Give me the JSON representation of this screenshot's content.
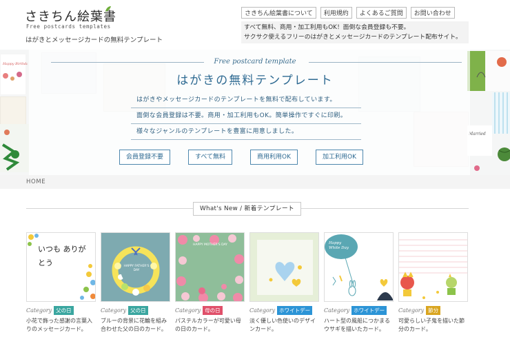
{
  "header": {
    "logo_title": "さきちん絵葉書",
    "logo_sub": "Free postcards templates",
    "tagline": "はがきとメッセージカードの無料テンプレート",
    "nav": [
      "さきちん絵葉書について",
      "利用規約",
      "よくあるご質問",
      "お問い合わせ"
    ],
    "desc_line1": "すべて無料、商用・加工利用もOK！面倒な会員登録も不要。",
    "desc_line2": "サクサク使えるフリーのはがきとメッセージカードのテンプレート配布サイト。"
  },
  "hero": {
    "script": "Free postcard template",
    "title": "はがきの無料テンプレート",
    "lines": [
      "はがきやメッセージカードのテンプレートを無料で配布しています。",
      "面倒な会員登録は不要。商用・加工利用もOK。簡単操作ですぐに印刷。",
      "様々なジャンルのテンプレートを豊富に用意しました。"
    ],
    "buttons": [
      "会員登録不要",
      "すべて無料",
      "商用利用OK",
      "加工利用OK"
    ]
  },
  "breadcrumb": "HOME",
  "whats_new": "What's New / 新着テンプレート",
  "colors": {
    "accent": "#2e6a92",
    "badge_teal": "#3aa6a0",
    "badge_red": "#e0506a",
    "badge_blue": "#2c94d6",
    "badge_yellow": "#d9a520"
  },
  "cards": [
    {
      "category_label": "Category",
      "badge": "父の日",
      "badge_color": "#3aa6a0",
      "desc": "小花で飾った感謝の言葉入りのメッセージカード。",
      "thumb_text": "いつも ありがとう"
    },
    {
      "category_label": "Category",
      "badge": "父の日",
      "badge_color": "#3aa6a0",
      "desc": "ブルーの背景に花輪を組み合わせた父の日のカード。",
      "thumb_text": "HAPPY FATHER'S DAY"
    },
    {
      "category_label": "Category",
      "badge": "母の日",
      "badge_color": "#e0506a",
      "desc": "パステルカラーが可愛い母の日のカード。",
      "thumb_text": "HAPPY MOTHER'S DAY"
    },
    {
      "category_label": "Category",
      "badge": "ホワイトデー",
      "badge_color": "#2c94d6",
      "desc": "淡く優しい色使いのデザインカード。",
      "thumb_text": ""
    },
    {
      "category_label": "Category",
      "badge": "ホワイトデー",
      "badge_color": "#2c94d6",
      "desc": "ハート型の風船につかまるウサギを描いたカード。",
      "thumb_text": "Happy White Day"
    },
    {
      "category_label": "Category",
      "badge": "節分",
      "badge_color": "#d9a520",
      "desc": "可愛らしい子鬼を描いた節分のカード。",
      "thumb_text": ""
    }
  ]
}
